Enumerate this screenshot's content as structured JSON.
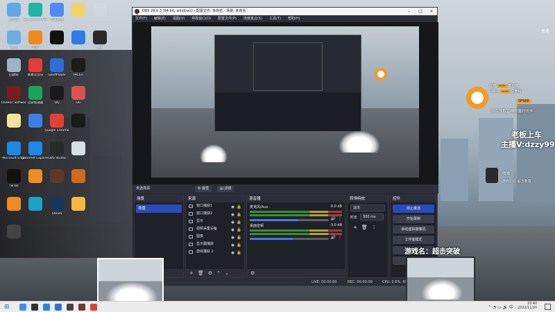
{
  "desktop": {
    "icons": [
      {
        "label": "此电脑",
        "color": "#5ea9e6"
      },
      {
        "label": "SteelSeries GG",
        "color": "#1db5a4"
      },
      {
        "label": "百度网盘",
        "color": "#4d8cf5"
      },
      {
        "label": "",
        "color": "#f2d36a"
      },
      {
        "label": "",
        "color": "#cfd7df"
      },
      {
        "label": "网络",
        "color": "#6aaee6"
      },
      {
        "label": "夸克",
        "color": "#f18a1e"
      },
      {
        "label": "",
        "color": "#111111"
      },
      {
        "label": "",
        "color": "#2d7be6"
      },
      {
        "label": "WZ",
        "color": "#2a2a2a"
      },
      {
        "label": "回收站",
        "color": "#9fb3c7"
      },
      {
        "label": "网易云音乐",
        "color": "#e23c3c"
      },
      {
        "label": "GoodPlayer",
        "color": "#2c6fd9"
      },
      {
        "label": "FACEIT",
        "color": "#1c1c1c"
      },
      {
        "label": "Steam",
        "color": "#0c2a4a"
      },
      {
        "label": "Radeon Software",
        "color": "#7a1d1d"
      },
      {
        "label": "迅游加速器",
        "color": "#17a55c"
      },
      {
        "label": "QQ",
        "color": "#1a1a1a"
      },
      {
        "label": "GG",
        "color": "#d9534f"
      },
      {
        "label": "GeForce Experience",
        "color": "#2f9e2f"
      },
      {
        "label": "",
        "color": "#f5e59a"
      },
      {
        "label": "",
        "color": "#3f7ee8"
      },
      {
        "label": "Google Chrome",
        "color": "#e44133"
      },
      {
        "label": "",
        "color": "#1b1b1b"
      },
      {
        "label": "CapCut",
        "color": "#000000"
      },
      {
        "label": "Microsoft Edge",
        "color": "#1e88e5"
      },
      {
        "label": "Internet Explorer",
        "color": "#1e88e5"
      },
      {
        "label": "OBS Studio",
        "color": "#2a2a2a"
      },
      {
        "label": "",
        "color": "#d9dee3"
      },
      {
        "label": "",
        "color": "#4c6bd6"
      },
      {
        "label": "TikTok",
        "color": "#111111"
      },
      {
        "label": "",
        "color": "#ef8c22"
      },
      {
        "label": "",
        "color": "#5b3a2a"
      },
      {
        "label": "",
        "color": "#d2691e"
      },
      {
        "label": "Logitech G HUB",
        "color": "#1b1b1b"
      },
      {
        "label": "",
        "color": "#ef8c22"
      },
      {
        "label": "",
        "color": "#1aa2c9"
      },
      {
        "label": "Steam",
        "color": "#17385c"
      },
      {
        "label": "",
        "color": "#f5b841"
      },
      {
        "label": "微信",
        "color": "#2dc100"
      },
      {
        "label": "",
        "color": "#444444"
      }
    ]
  },
  "obs": {
    "title": "OBS 28.0.3 (64-bit, windows) - 配置文件: 未命名 - 场景: 未命名",
    "menu": [
      "文件(F)",
      "编辑(E)",
      "视图(V)",
      "停靠窗口(D)",
      "配置文件(P)",
      "场景集合(S)",
      "工具(T)",
      "帮助(H)"
    ],
    "source_bar": {
      "label": "未选择源",
      "props": "属性",
      "filters": "滤镜"
    },
    "scenes": {
      "title": "场景",
      "items": [
        "场景"
      ]
    },
    "sources": {
      "title": "来源",
      "items": [
        "窗口捕获1",
        "窗口捕获2",
        "显示",
        "视频采集设备",
        "图像",
        "显示器捕获",
        "游戏捕获 2"
      ]
    },
    "mixer": {
      "title": "混音器",
      "channels": [
        {
          "name": "麦克风/Aux",
          "db": "0.0 dB",
          "level": 0.62
        },
        {
          "name": "桌面音频",
          "db": "-3.0 dB",
          "level": 0.55
        }
      ]
    },
    "transitions": {
      "title": "转场特效",
      "type": "淡出",
      "duration_label": "时长",
      "duration": "300 ms"
    },
    "controls": {
      "title": "控件",
      "buttons": [
        "停止推流",
        "开始录制",
        "启动虚拟摄像机",
        "工作室模式",
        "设置",
        "退出"
      ]
    },
    "status": {
      "live": "LIVE: 00:00:00",
      "rec": "REC: 00:00:00",
      "cpu": "CPU: 0.6%, 60.00 fps"
    }
  },
  "overlay": {
    "promo_line1": "打开",
    "promo_line2": "客户端",
    "promo_line3": "输入",
    "promo_line4": "兑换码",
    "promo_code": "SP666",
    "promo_desc": "即可领取音神限量时长卡",
    "follow_line1": "老板上车",
    "follow_line2": "主播V:dzzy99",
    "gift_name": "微微",
    "gift_text": "德西尔伯-超击敢载",
    "game_label": "游戏名：",
    "game_name": "超击突破",
    "top_right": "吊毛"
  },
  "taskbar": {
    "time": "20:40",
    "date": "2022/11/20",
    "icons": [
      {
        "color": "#3b8ef0"
      },
      {
        "color": "#333333"
      },
      {
        "color": "#1e88e5"
      },
      {
        "color": "#2f6fd8"
      },
      {
        "color": "#444444"
      },
      {
        "color": "#6f3b2b"
      },
      {
        "color": "#e23c3c"
      }
    ]
  }
}
